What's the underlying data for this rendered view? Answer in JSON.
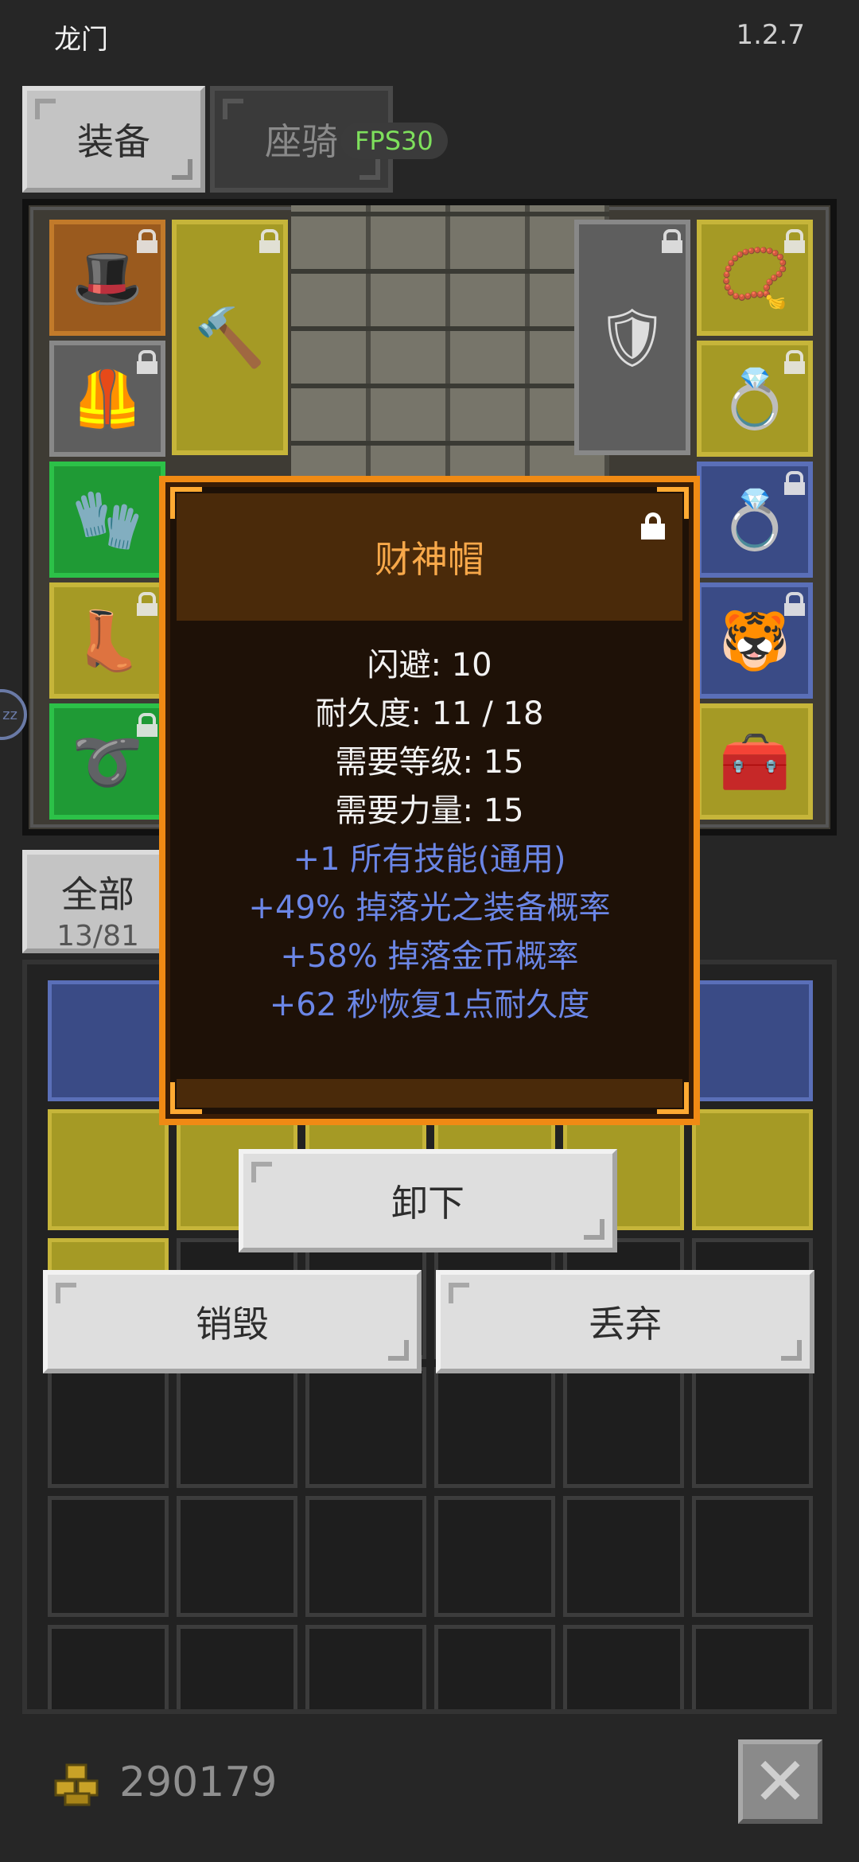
{
  "status_bar": {
    "title": "龙门",
    "version": "1.2.7"
  },
  "tabs": [
    {
      "label": "装备"
    },
    {
      "label": "座骑"
    }
  ],
  "fps": "FPS30",
  "category": {
    "label": "全部",
    "count": "13/81"
  },
  "side_toggle": "zz",
  "tooltip": {
    "name": "财神帽",
    "stats": [
      "闪避: 10",
      "耐久度: 11 / 18",
      "需要等级: 15",
      "需要力量: 15"
    ],
    "bonuses": [
      "+1 所有技能(通用)",
      "+49% 掉落光之装备概率",
      "+58% 掉落金币概率",
      "+62 秒恢复1点耐久度"
    ]
  },
  "actions": {
    "unequip": "卸下",
    "destroy": "销毁",
    "discard": "丢弃"
  },
  "gold": {
    "amount": "290179"
  },
  "colors": {
    "accent": "#f08a14",
    "item_name": "#f7a84a",
    "bonus": "#6b86e6",
    "fps": "#7ee05c"
  },
  "equip_slots": [
    {
      "icon": "hat-icon",
      "glyph": "🎩",
      "rarity": "orange"
    },
    {
      "icon": "armor-icon",
      "glyph": "🦺",
      "rarity": "gray"
    },
    {
      "icon": "gauntlet-icon",
      "glyph": "🧤",
      "rarity": "green"
    },
    {
      "icon": "boots-icon",
      "glyph": "👢",
      "rarity": "yellow"
    },
    {
      "icon": "belt-icon",
      "glyph": "➰",
      "rarity": "green"
    },
    {
      "icon": "weapon-icon",
      "glyph": "🔨",
      "rarity": "yellow"
    },
    {
      "icon": "shield-icon",
      "glyph": "🛡",
      "rarity": "gray"
    },
    {
      "icon": "amulet-icon",
      "glyph": "📿",
      "rarity": "yellow"
    },
    {
      "icon": "ring-blue-icon",
      "glyph": "💍",
      "rarity": "yellow"
    },
    {
      "icon": "ring-green-icon",
      "glyph": "💍",
      "rarity": "blue"
    },
    {
      "icon": "mount-charm-icon",
      "glyph": "🐯",
      "rarity": "blue"
    },
    {
      "icon": "chest-icon",
      "glyph": "🧰",
      "rarity": "yellow"
    }
  ]
}
